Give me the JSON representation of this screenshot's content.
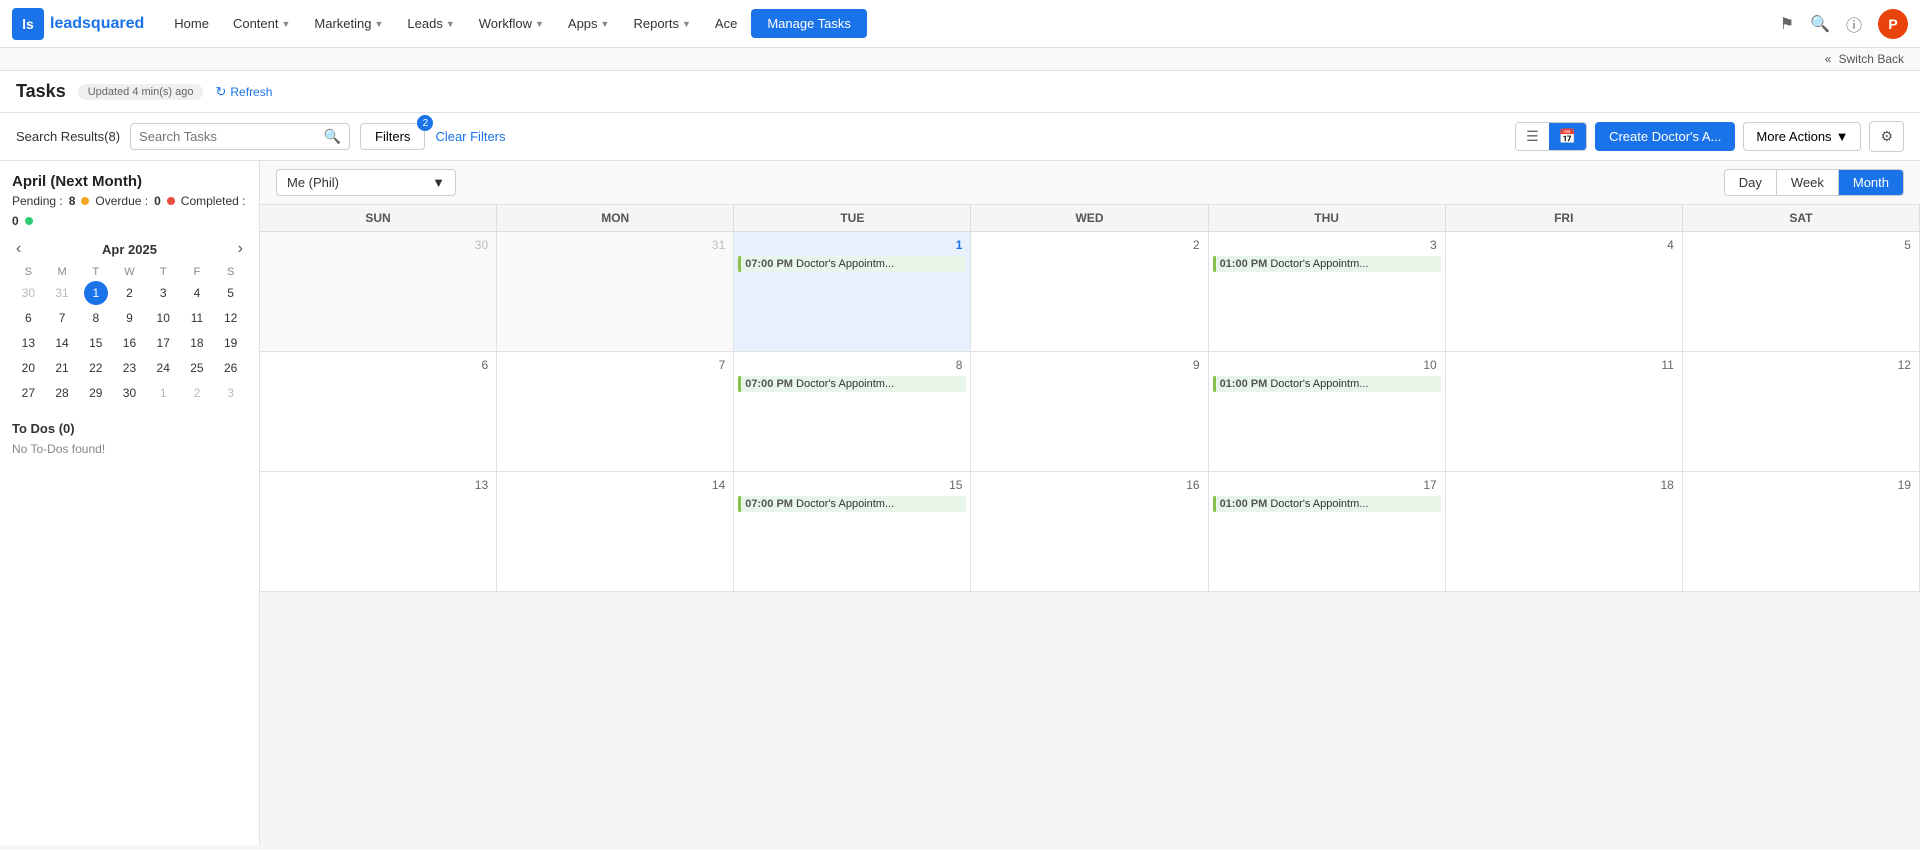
{
  "logo": {
    "abbr": "ls",
    "full_text": "leadsquared"
  },
  "nav": {
    "home": "Home",
    "content": "Content",
    "marketing": "Marketing",
    "leads": "Leads",
    "workflow": "Workflow",
    "apps": "Apps",
    "reports": "Reports",
    "ace": "Ace",
    "manage_tasks": "Manage Tasks"
  },
  "switch_back": "Switch Back",
  "tasks": {
    "title": "Tasks",
    "updated": "Updated 4 min(s) ago",
    "refresh": "Refresh",
    "search_results_label": "Search Results(8)",
    "search_placeholder": "Search Tasks",
    "filters_label": "Filters",
    "filters_count": "2",
    "clear_filters": "Clear Filters",
    "create_btn": "Create Doctor's A...",
    "more_actions": "More Actions",
    "month_title": "April (Next Month)",
    "pending_label": "Pending :",
    "pending_count": "8",
    "overdue_label": "Overdue :",
    "overdue_count": "0",
    "completed_label": "Completed :",
    "completed_count": "0"
  },
  "mini_calendar": {
    "title": "Apr 2025",
    "days_of_week": [
      "S",
      "M",
      "T",
      "W",
      "T",
      "F",
      "S"
    ],
    "weeks": [
      [
        {
          "d": "30",
          "other": true
        },
        {
          "d": "31",
          "other": true
        },
        {
          "d": "1",
          "today": true
        },
        {
          "d": "2"
        },
        {
          "d": "3"
        },
        {
          "d": "4"
        },
        {
          "d": "5"
        }
      ],
      [
        {
          "d": "6"
        },
        {
          "d": "7"
        },
        {
          "d": "8"
        },
        {
          "d": "9"
        },
        {
          "d": "10"
        },
        {
          "d": "11"
        },
        {
          "d": "12"
        }
      ],
      [
        {
          "d": "13"
        },
        {
          "d": "14"
        },
        {
          "d": "15"
        },
        {
          "d": "16"
        },
        {
          "d": "17"
        },
        {
          "d": "18"
        },
        {
          "d": "19"
        }
      ],
      [
        {
          "d": "20"
        },
        {
          "d": "21"
        },
        {
          "d": "22"
        },
        {
          "d": "23"
        },
        {
          "d": "24"
        },
        {
          "d": "25"
        },
        {
          "d": "26"
        }
      ],
      [
        {
          "d": "27"
        },
        {
          "d": "28"
        },
        {
          "d": "29"
        },
        {
          "d": "30"
        },
        {
          "d": "1",
          "other": true
        },
        {
          "d": "2",
          "other": true
        },
        {
          "d": "3",
          "other": true
        }
      ]
    ]
  },
  "todos": {
    "title": "To Dos (0)",
    "empty_message": "No To-Dos found!"
  },
  "calendar_controls": {
    "assignee": "Me (Phil)",
    "day": "Day",
    "week": "Week",
    "month": "Month"
  },
  "calendar_headers": [
    "SUN",
    "MON",
    "TUE",
    "WED",
    "THU",
    "FRI",
    "SAT"
  ],
  "calendar_weeks": [
    [
      {
        "d": "30",
        "other": true,
        "events": []
      },
      {
        "d": "31",
        "other": true,
        "events": []
      },
      {
        "d": "1",
        "today": true,
        "events": [
          {
            "time": "07:00 PM",
            "title": "Doctor's Appointm..."
          }
        ]
      },
      {
        "d": "2",
        "events": []
      },
      {
        "d": "3",
        "events": [
          {
            "time": "01:00 PM",
            "title": "Doctor's Appointm..."
          }
        ]
      },
      {
        "d": "4",
        "events": []
      },
      {
        "d": "5",
        "events": []
      }
    ],
    [
      {
        "d": "6",
        "events": []
      },
      {
        "d": "7",
        "events": []
      },
      {
        "d": "8",
        "events": [
          {
            "time": "07:00 PM",
            "title": "Doctor's Appointm..."
          }
        ]
      },
      {
        "d": "9",
        "events": []
      },
      {
        "d": "10",
        "events": [
          {
            "time": "01:00 PM",
            "title": "Doctor's Appointm..."
          }
        ]
      },
      {
        "d": "11",
        "events": []
      },
      {
        "d": "12",
        "events": []
      }
    ],
    [
      {
        "d": "13",
        "events": []
      },
      {
        "d": "14",
        "events": []
      },
      {
        "d": "15",
        "events": [
          {
            "time": "07:00 PM",
            "title": "Doctor's Appointm..."
          }
        ]
      },
      {
        "d": "16",
        "events": []
      },
      {
        "d": "17",
        "events": [
          {
            "time": "01:00 PM",
            "title": "Doctor's Appointm..."
          }
        ]
      },
      {
        "d": "18",
        "events": []
      },
      {
        "d": "19",
        "events": []
      }
    ]
  ],
  "user_avatar": "P",
  "user_avatar_bg": "#e8430a"
}
